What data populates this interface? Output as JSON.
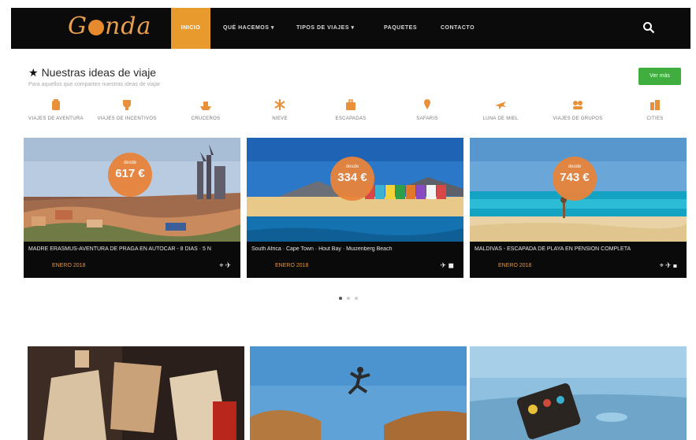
{
  "nav": {
    "logo": "Gconda",
    "items": [
      {
        "label": "INICIO"
      },
      {
        "label": "QUÉ HACEMOS ▾"
      },
      {
        "label": "TIPOS DE VIAJES ▾"
      },
      {
        "label": "PAQUETES"
      },
      {
        "label": "CONTACTO"
      }
    ],
    "search_icon": "search-icon",
    "accent": "#e89a2c"
  },
  "section": {
    "title": "Nuestras ideas de viaje",
    "subtitle": "Para aquellos que comparten nuestras ideas de viajar",
    "button_label": "Ver más"
  },
  "categories": [
    {
      "label": "VIAJES DE AVENTURA",
      "icon": "backpack-icon"
    },
    {
      "label": "VIAJES DE INCENTIVOS",
      "icon": "trophy-icon"
    },
    {
      "label": "CRUCEROS",
      "icon": "ship-icon"
    },
    {
      "label": "NIEVE",
      "icon": "snowflake-icon"
    },
    {
      "label": "ESCAPADAS",
      "icon": "suitcase-icon"
    },
    {
      "label": "SAFARIS",
      "icon": "pin-icon"
    },
    {
      "label": "LUNA DE MIEL",
      "icon": "plane-icon"
    },
    {
      "label": "VIAJES DE GRUPOS",
      "icon": "group-icon"
    },
    {
      "label": "CITIES",
      "icon": "city-icon"
    }
  ],
  "cards": [
    {
      "price_label": "desde",
      "price": "617 €",
      "title": "MADRE ERASMUS-AVENTURA DE PRAGA EN AUTOCAR - 8 DIAS · 5 N",
      "dates": "ENERO 2018",
      "icons": "⌖ ✈"
    },
    {
      "price_label": "desde",
      "price": "334 €",
      "title": "South Africa · Cape Town · Hout Bay · Muizenberg Beach",
      "dates": "ENERO 2018",
      "icons": "✈ ◼"
    },
    {
      "price_label": "desde",
      "price": "743 €",
      "title": "MALDIVAS - ESCAPADA DE PLAYA EN PENSION COMPLETA",
      "dates": "ENERO 2018",
      "icons": "⌖ ✈ ◼"
    }
  ],
  "carousel": {
    "dots": 3,
    "active": 0
  }
}
